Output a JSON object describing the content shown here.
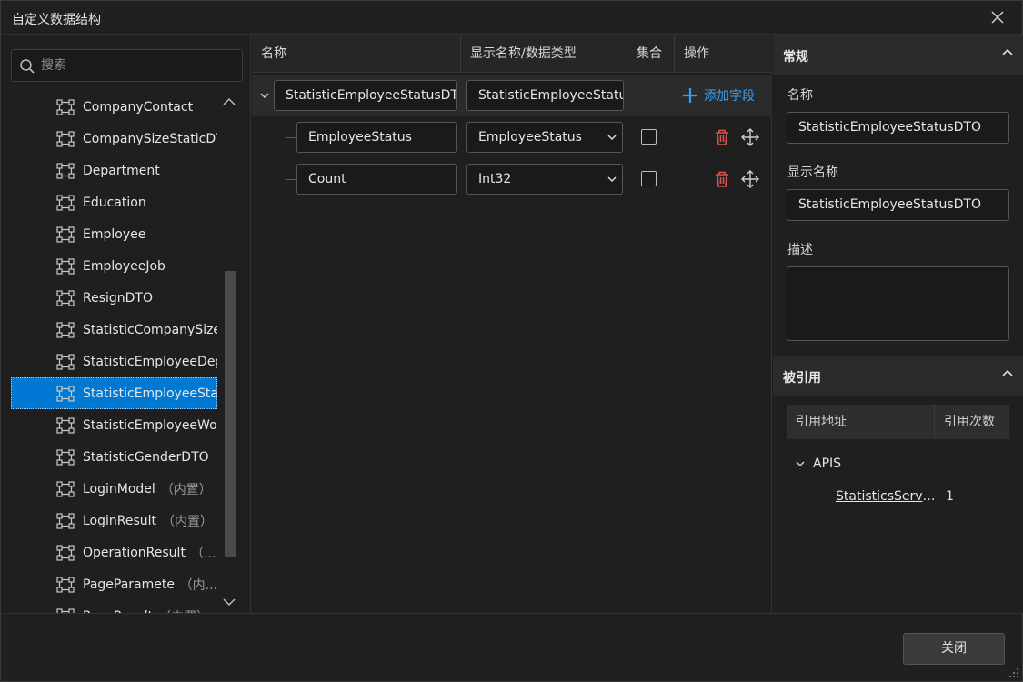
{
  "window": {
    "title": "自定义数据结构"
  },
  "search": {
    "placeholder": "搜索",
    "value": ""
  },
  "tree": {
    "items": [
      {
        "label": "CompanyContact",
        "suffix": ""
      },
      {
        "label": "CompanySizeStaticDTO",
        "suffix": ""
      },
      {
        "label": "Department",
        "suffix": ""
      },
      {
        "label": "Education",
        "suffix": ""
      },
      {
        "label": "Employee",
        "suffix": ""
      },
      {
        "label": "EmployeeJob",
        "suffix": ""
      },
      {
        "label": "ResignDTO",
        "suffix": ""
      },
      {
        "label": "StatisticCompanySizeDTO",
        "suffix": ""
      },
      {
        "label": "StatisticEmployeeDegreeDTO",
        "suffix": ""
      },
      {
        "label": "StatisticEmployeeStatusDTO",
        "suffix": "",
        "selected": true
      },
      {
        "label": "StatisticEmployeeWorkDTO",
        "suffix": ""
      },
      {
        "label": "StatisticGenderDTO",
        "suffix": ""
      },
      {
        "label": "LoginModel",
        "suffix": "（内置）"
      },
      {
        "label": "LoginResult",
        "suffix": "（内置）"
      },
      {
        "label": "OperationResult",
        "suffix": "（..."
      },
      {
        "label": "PageParameter",
        "suffix": "（内..."
      },
      {
        "label": "PageResult",
        "suffix": "（内置）"
      }
    ]
  },
  "grid": {
    "columns": {
      "name": "名称",
      "display_type": "显示名称/数据类型",
      "collection": "集合",
      "actions": "操作"
    },
    "parent": {
      "name": "StatisticEmployeeStatusDTO",
      "display": "StatisticEmployeeStatusDTO",
      "add_label": "添加字段"
    },
    "fields": [
      {
        "name": "EmployeeStatus",
        "type": "EmployeeStatus",
        "collection": false
      },
      {
        "name": "Count",
        "type": "Int32",
        "collection": false
      }
    ]
  },
  "props": {
    "general_title": "常规",
    "name_label": "名称",
    "name_value": "StatisticEmployeeStatusDTO",
    "display_label": "显示名称",
    "display_value": "StatisticEmployeeStatusDTO",
    "desc_label": "描述",
    "desc_value": ""
  },
  "refs": {
    "title": "被引用",
    "col_address": "引用地址",
    "col_count": "引用次数",
    "group": "APIS",
    "items": [
      {
        "address": "StatisticsService.GetEmployeeStatus",
        "count": "1"
      }
    ]
  },
  "footer": {
    "close_label": "关闭"
  },
  "colors": {
    "accent": "#0078d4",
    "link": "#3b9cf0",
    "danger": "#d9534f"
  }
}
